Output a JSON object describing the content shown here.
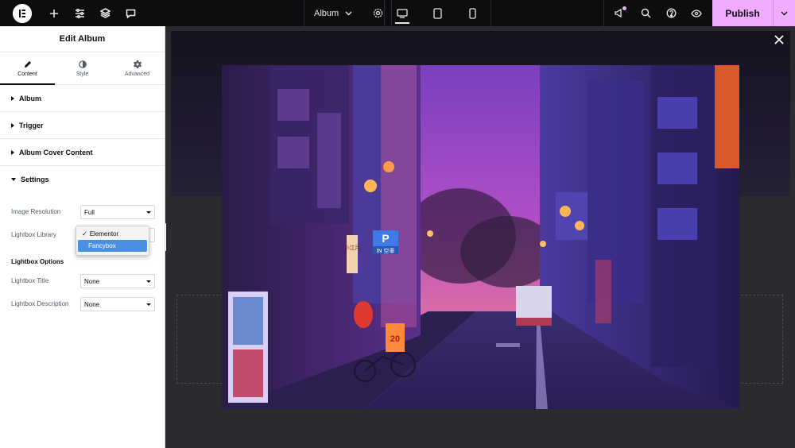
{
  "topbar": {
    "page_title": "Album",
    "publish_label": "Publish"
  },
  "sidebar": {
    "title": "Edit Album",
    "tabs": [
      {
        "label": "Content",
        "icon": "pencil-icon",
        "active": true
      },
      {
        "label": "Style",
        "icon": "half-circle-icon",
        "active": false
      },
      {
        "label": "Advanced",
        "icon": "gear-icon",
        "active": false
      }
    ],
    "sections": {
      "album": "Album",
      "trigger": "Trigger",
      "cover": "Album Cover Content",
      "settings": "Settings"
    },
    "controls": {
      "image_resolution_label": "Image Resolution",
      "image_resolution_value": "Full",
      "lightbox_library_label": "Lightbox Library",
      "lightbox_options_heading": "Lightbox Options",
      "lightbox_title_label": "Lightbox Title",
      "lightbox_title_value": "None",
      "lightbox_description_label": "Lightbox Description",
      "lightbox_description_value": "None"
    },
    "dropdown": {
      "options": [
        "Elementor",
        "Fancybox"
      ],
      "checked": "Elementor",
      "highlighted": "Fancybox"
    }
  },
  "photo": {
    "signs": {
      "parking": "P",
      "in": "IN 空車",
      "tall_sign": "小江戸",
      "orange_sign": "20"
    }
  },
  "colors": {
    "accent_publish": "#f0abfc",
    "topbar_bg": "#0c0d0e",
    "highlight": "#4a90e2"
  }
}
